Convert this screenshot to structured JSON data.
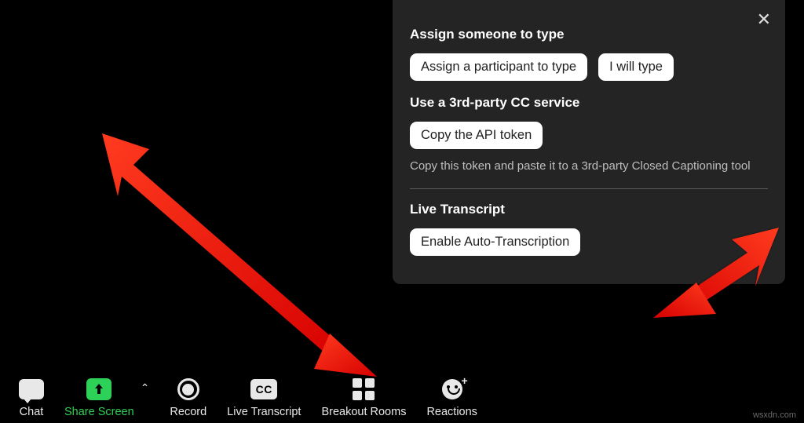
{
  "popup": {
    "section1": {
      "heading": "Assign someone to type",
      "btn_assign": "Assign a participant to type",
      "btn_self": "I will type"
    },
    "section2": {
      "heading": "Use a 3rd-party CC service",
      "btn_copy": "Copy the API token",
      "desc": "Copy this token and paste it to a 3rd-party Closed Captioning tool"
    },
    "section3": {
      "heading": "Live Transcript",
      "btn_enable": "Enable Auto-Transcription"
    }
  },
  "toolbar": {
    "chat": "Chat",
    "share": "Share Screen",
    "record": "Record",
    "transcript": "Live Transcript",
    "breakout": "Breakout Rooms",
    "reactions": "Reactions",
    "cc_text": "CC"
  },
  "watermark": "wsxdn.com"
}
